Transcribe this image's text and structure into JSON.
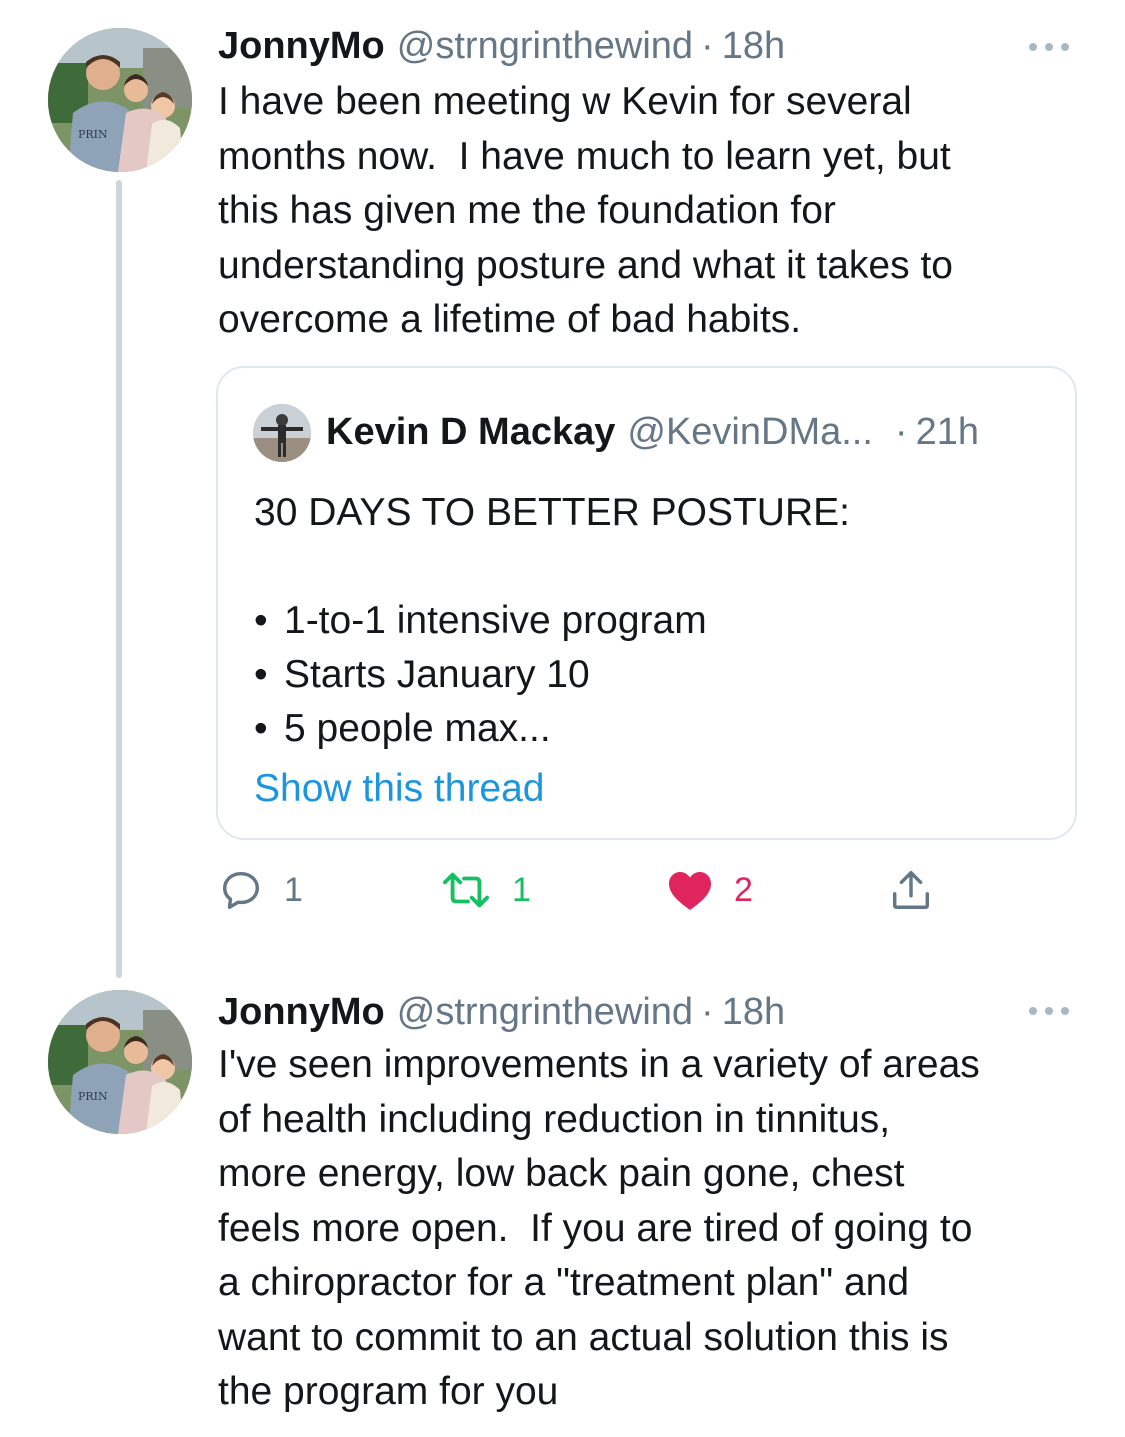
{
  "tweets": [
    {
      "author": {
        "name": "JonnyMo",
        "handle": "@strngrinthewind",
        "separator": "·",
        "time": "18h"
      },
      "text": "I have been meeting w Kevin for several\nmonths now.  I have much to learn yet, but\nthis has given me the foundation for\nunderstanding posture and what it takes to\novercome a lifetime of bad habits.",
      "quoted": {
        "name": "Kevin D Mackay",
        "handle": "@KevinDMa...",
        "separator": "·",
        "time": "21h",
        "headline": "30 DAYS TO BETTER POSTURE:",
        "bullet_symbol": "•",
        "bullets": [
          "1-to-1 intensive program",
          "Starts January 10",
          "5 people max..."
        ],
        "show_thread_label": "Show this thread"
      },
      "actions": {
        "replies": "1",
        "retweets": "1",
        "likes": "2"
      }
    },
    {
      "author": {
        "name": "JonnyMo",
        "handle": "@strngrinthewind",
        "separator": "·",
        "time": "18h"
      },
      "text": "I've seen improvements in a variety of areas\nof health including reduction in tinnitus,\nmore energy, low back pain gone, chest\nfeels more open.  If you are tired of going to\na chiropractor for a \"treatment plan\" and\nwant to commit to an actual solution this is\nthe program for you"
    }
  ],
  "icons": {
    "reply": "reply-icon",
    "retweet": "retweet-icon",
    "like": "heart-icon",
    "share": "share-icon",
    "more": "more-options-icon"
  },
  "colors": {
    "text": "#14171a",
    "secondary": "#657786",
    "link": "#1b95e0",
    "retweet": "#17bf63",
    "like": "#e0245e",
    "border": "#e1e8ed",
    "thread_line": "#ccd6dd"
  }
}
